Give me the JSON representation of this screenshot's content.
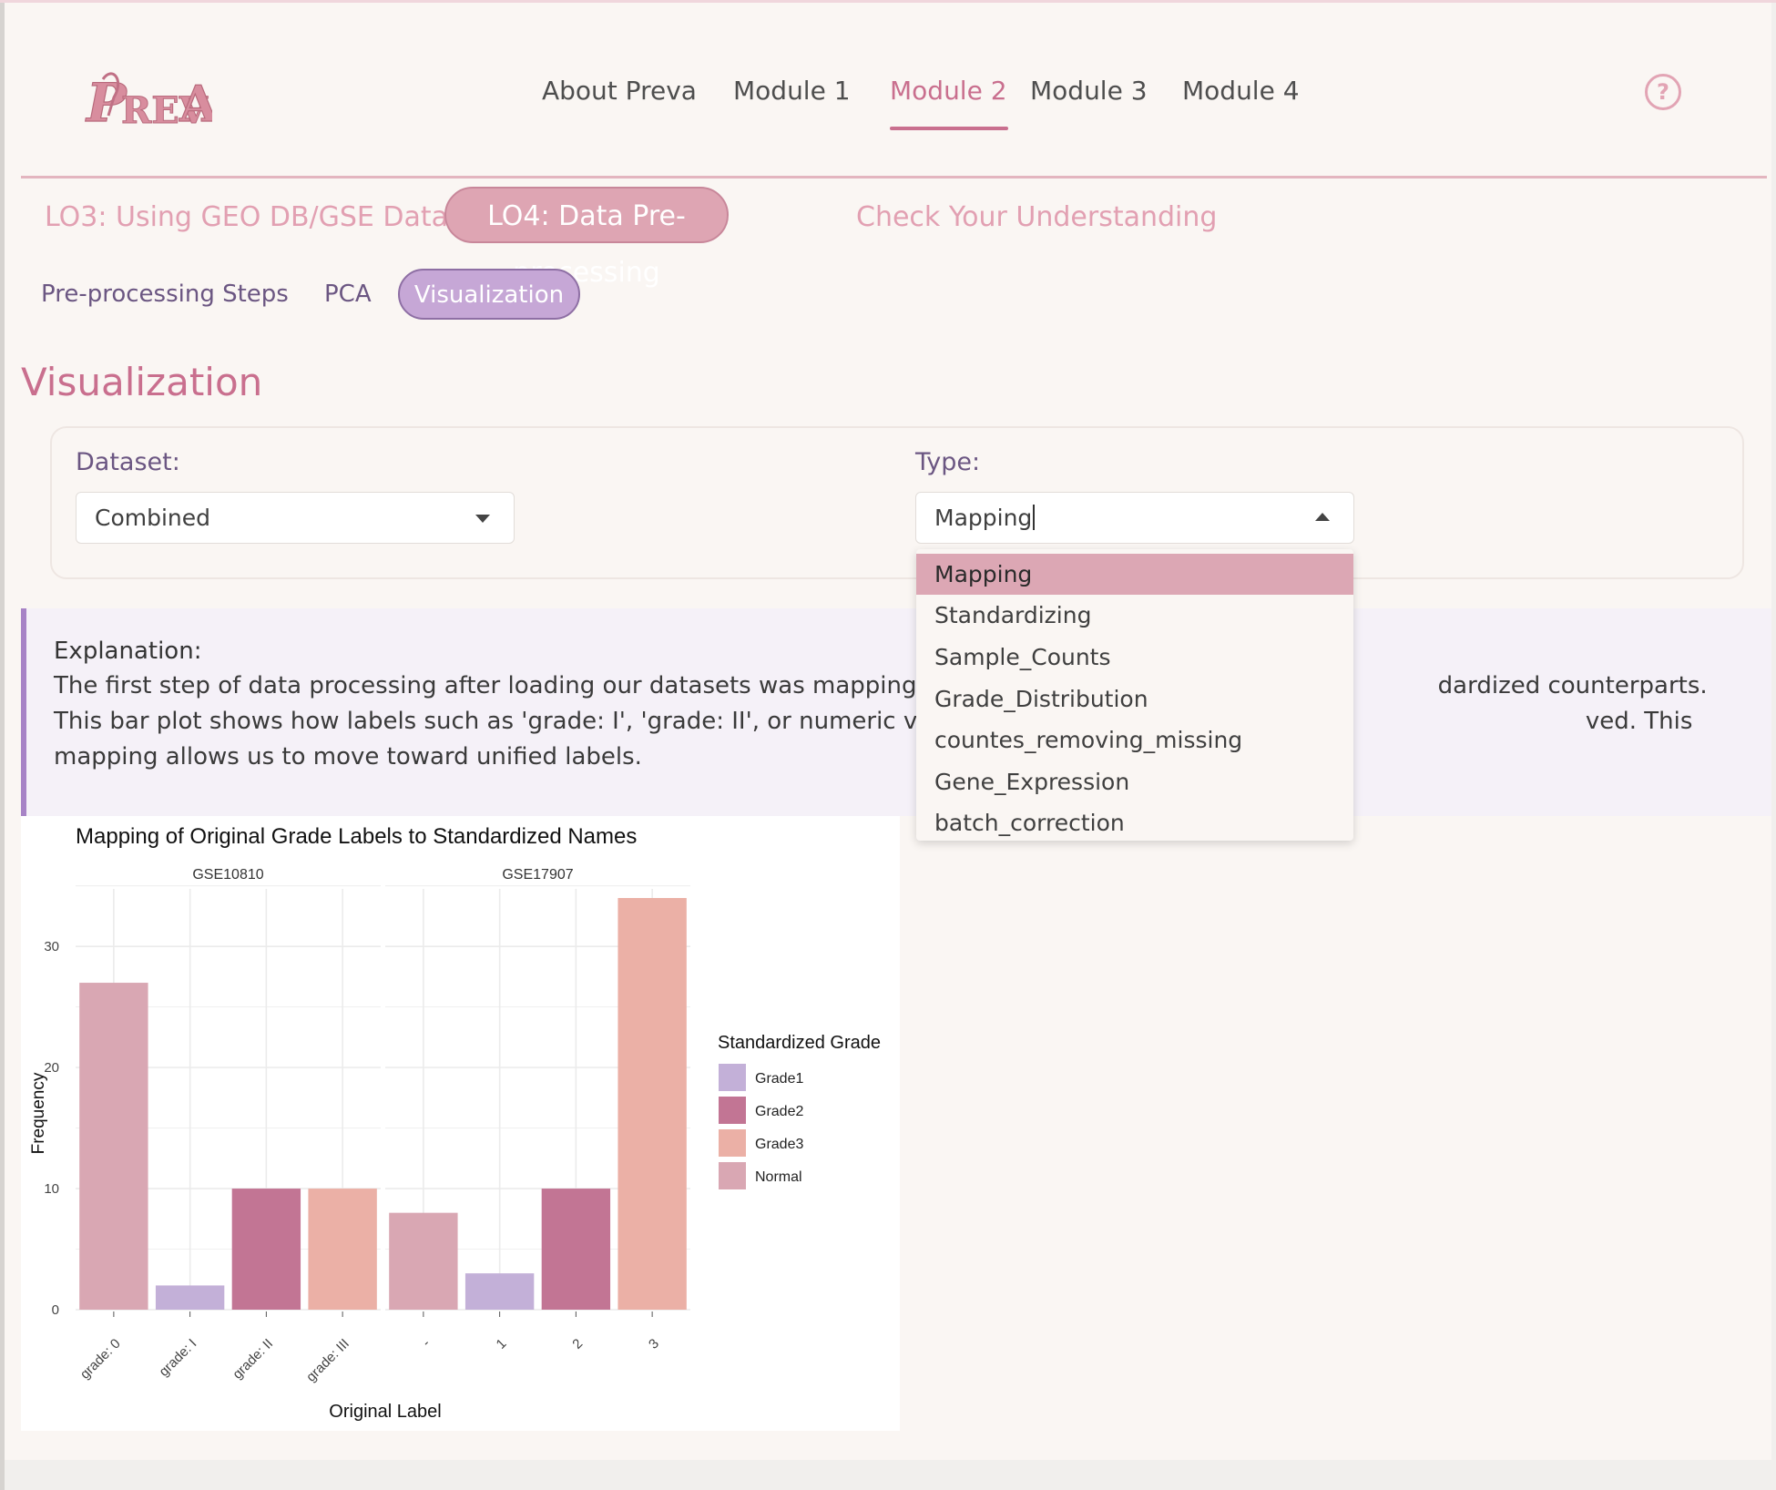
{
  "app": {
    "logo_text": "PREVA",
    "nav": [
      {
        "label": "About Preva"
      },
      {
        "label": "Module 1"
      },
      {
        "label": "Module 2"
      },
      {
        "label": "Module 3"
      },
      {
        "label": "Module 4"
      }
    ],
    "active_nav": "Module 2",
    "help_icon": "question-circle-icon"
  },
  "lo_tabs": [
    {
      "label": "LO3: Using GEO DB/GSE Data"
    },
    {
      "label": "LO4: Data Pre-processing"
    },
    {
      "label": "Check Your Understanding"
    }
  ],
  "sub_tabs": [
    {
      "label": "Pre-processing Steps"
    },
    {
      "label": "PCA"
    },
    {
      "label": "Visualization"
    }
  ],
  "section_title": "Visualization",
  "controls": {
    "dataset_label": "Dataset:",
    "dataset_value": "Combined",
    "type_label": "Type:",
    "type_value": "Mapping",
    "type_options": [
      "Mapping",
      "Standardizing",
      "Sample_Counts",
      "Grade_Distribution",
      "countes_removing_missing",
      "Gene_Expression",
      "batch_correction"
    ],
    "type_selected_option": "Mapping"
  },
  "explanation": {
    "title": "Explanation:",
    "text": "The first step of data processing after loading our datasets was mapping t                                                                   dardized counterparts. This bar plot shows how labels such as 'grade: I', 'grade: II', or numeric values like 1, 2                                                                   ved. This mapping allows us to move toward unified labels."
  },
  "colors": {
    "accent": "#c96f8e",
    "Grade1": "#c3b0d8",
    "Grade2": "#c27594",
    "Grade3": "#ebb0a6",
    "Normal": "#d9a7b3"
  },
  "chart_data": {
    "type": "bar",
    "title": "Mapping of Original Grade Labels to Standardized Names",
    "xlabel": "Original Label",
    "ylabel": "Frequency",
    "ylim": [
      0,
      35
    ],
    "yticks": [
      0,
      10,
      20,
      30
    ],
    "grid": true,
    "legend_title": "Standardized Grade",
    "legend_position": "right",
    "legend": [
      "Grade1",
      "Grade2",
      "Grade3",
      "Normal"
    ],
    "facets": [
      {
        "name": "GSE10810",
        "categories": [
          "grade: 0",
          "grade: I",
          "grade: II",
          "grade: III"
        ],
        "values": [
          27,
          2,
          10,
          10
        ],
        "groups": [
          "Normal",
          "Grade1",
          "Grade2",
          "Grade3"
        ]
      },
      {
        "name": "GSE17907",
        "categories": [
          "-",
          "1",
          "2",
          "3"
        ],
        "values": [
          8,
          3,
          10,
          34
        ],
        "groups": [
          "Normal",
          "Grade1",
          "Grade2",
          "Grade3"
        ]
      }
    ]
  }
}
